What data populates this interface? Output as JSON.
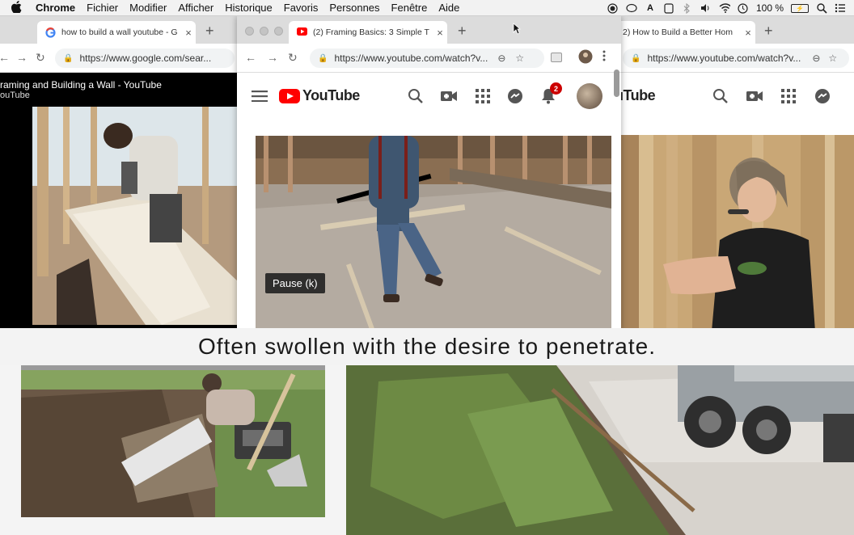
{
  "menubar": {
    "app": "Chrome",
    "items": [
      "Fichier",
      "Modifier",
      "Afficher",
      "Historique",
      "Favoris",
      "Personnes",
      "Fenêtre",
      "Aide"
    ],
    "battery": "100 %"
  },
  "left_window": {
    "tab_title": "how to build a wall youtube - G",
    "url": "https://www.google.com/sear...",
    "video_title": "raming and Building a Wall - YouTube",
    "video_channel": "ouTube"
  },
  "center_window": {
    "tab_title": "(2) Framing Basics: 3 Simple T",
    "url": "https://www.youtube.com/watch?v...",
    "youtube_logo": "YouTube",
    "notification_count": "2",
    "tooltip": "Pause (k)"
  },
  "right_window": {
    "tab_title": "2) How to Build a Better Hom",
    "url": "https://www.youtube.com/watch?v...",
    "youtube_logo": "uTube"
  },
  "caption": "Often swollen with the desire to penetrate.",
  "icons": {
    "apple": "apple-icon",
    "search": "search-icon",
    "camera": "video-camera-icon",
    "apps": "apps-grid-icon",
    "messages": "messages-icon",
    "bell": "bell-icon"
  }
}
